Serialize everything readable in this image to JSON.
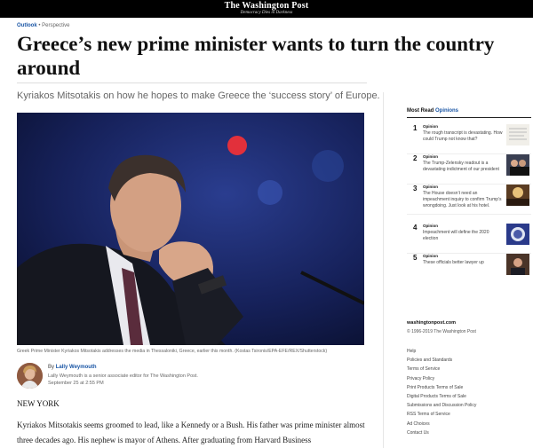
{
  "masthead": {
    "title": "The Washington Post",
    "tagline": "Democracy Dies in Darkness"
  },
  "article": {
    "section": "Outlook",
    "kicker_sep": "•",
    "label": "Perspective",
    "headline": "Greece’s new prime minister wants to turn the country around",
    "dek": "Kyriakos Mitsotakis on how he hopes to make Greece the ‘success story’ of Europe.",
    "caption": "Greek Prime Minister Kyriakos Mitsotakis addresses the media in Thessaloniki, Greece, earlier this month. (Kostas Tsironis/EPA-EFE/REX/Shutterstock)",
    "byline_prefix": "By",
    "author": "Lally Weymouth",
    "author_bio": "Lally Weymouth is a senior associate editor for The Washington Post.",
    "date": "September 25 at 2:55 PM",
    "dateline": "NEW YORK",
    "body": "Kyriakos Mitsotakis seems groomed to lead, like a Kennedy or a Bush. His father was prime minister almost three decades ago. His nephew is mayor of Athens. After graduating from Harvard Business"
  },
  "most_read": {
    "title": "Most Read",
    "title_accent": "Opinions",
    "items": [
      {
        "num": "1",
        "label": "Opinion",
        "text": "The rough transcript is devastating. How could Trump not know that?",
        "thumb": "document-thumbnail"
      },
      {
        "num": "2",
        "label": "Opinion",
        "text": "The Trump-Zelensky readout is a devastating indictment of our president",
        "thumb": "meeting-photo-thumbnail"
      },
      {
        "num": "3",
        "label": "Opinion",
        "text": "The House doesn’t need an impeachment inquiry to confirm Trump’s wrongdoing. Just look at his hotel.",
        "thumb": "hotel-lobby-thumbnail"
      },
      {
        "num": "4",
        "label": "Opinion",
        "text": "Impeachment will define the 2020 election",
        "thumb": "capitol-thumbnail"
      },
      {
        "num": "5",
        "label": "Opinion",
        "text": "These officials better lawyer up",
        "thumb": "portrait-thumbnail"
      }
    ]
  },
  "footer": {
    "site": "washingtonpost.com",
    "copyright": "© 1996-2019 The Washington Post",
    "links": [
      "Help",
      "Policies and Standards",
      "Terms of Service",
      "Privacy Policy",
      "Print Products Terms of Sale",
      "Digital Products Terms of Sale",
      "Submissions and Discussion Policy",
      "RSS Terms of Service",
      "Ad Choices",
      "Contact Us"
    ]
  },
  "colors": {
    "link_blue": "#1955a5",
    "masthead_bg": "#000000"
  }
}
